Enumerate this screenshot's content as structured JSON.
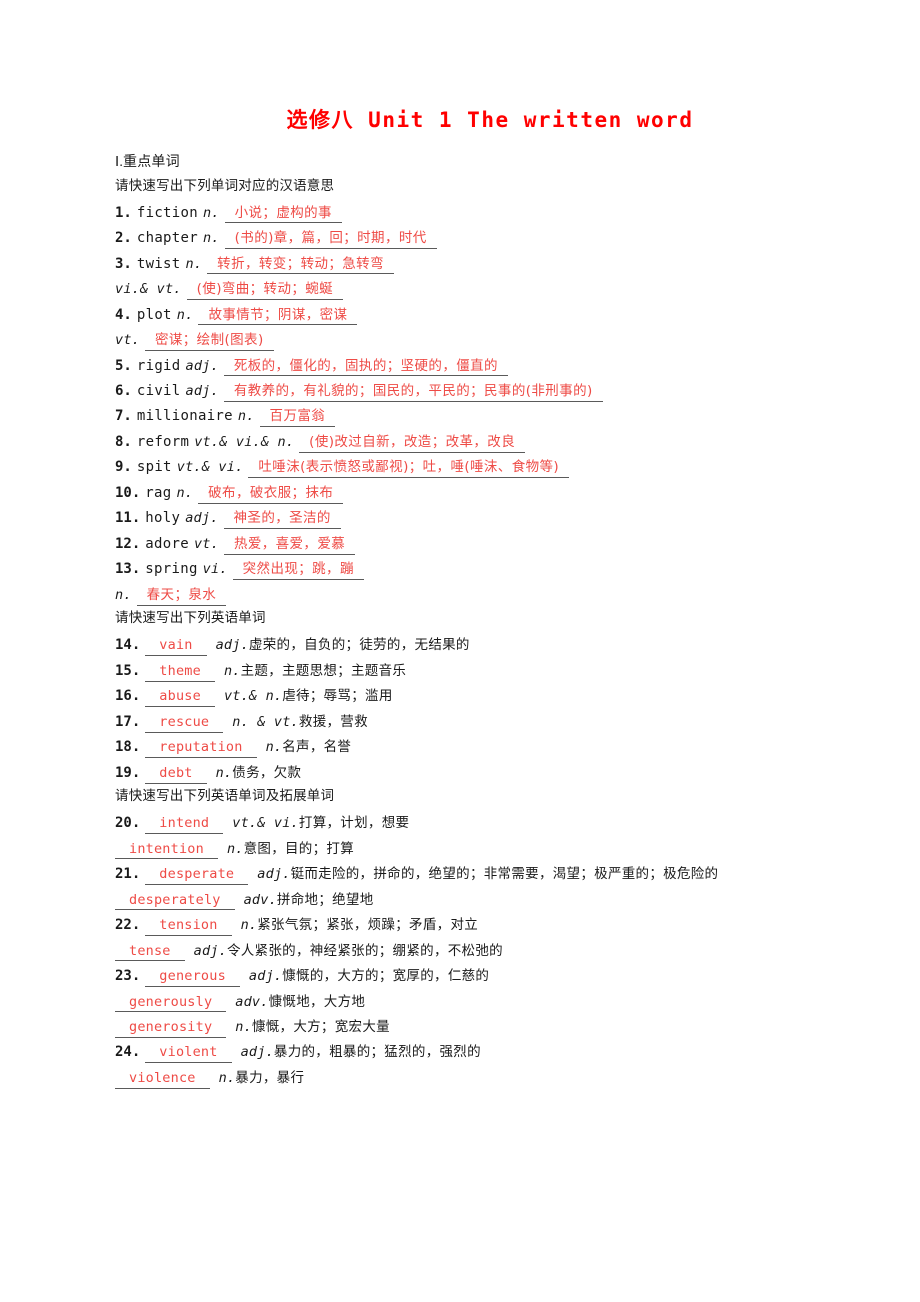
{
  "title": "选修八  Unit 1  The written word",
  "section_one_heading": "Ⅰ.重点单词",
  "prompts": {
    "zh_meaning": "请快速写出下列单词对应的汉语意思",
    "en_word": "请快速写出下列英语单词",
    "en_word_extended": "请快速写出下列英语单词及拓展单词"
  },
  "colors": {
    "title_red": "#ff0000",
    "answer_red": "#ee4b46",
    "text_black": "#1a1a1a",
    "rule_gray": "#5a5a5a"
  },
  "group_a": [
    {
      "num": "1.",
      "word": "fiction",
      "pos": "n.",
      "answer": "小说；虚构的事"
    },
    {
      "num": "2.",
      "word": "chapter",
      "pos": "n.",
      "answer": "(书的)章，篇，回；时期，时代"
    },
    {
      "num": "3.",
      "word": "twist",
      "pos": "n.",
      "answer": "转折，转变；转动；急转弯"
    },
    {
      "num": "",
      "word": "",
      "pos": "vi.& vt.",
      "answer": "(使)弯曲；转动；蜿蜒"
    },
    {
      "num": "4.",
      "word": "plot",
      "pos": "n.",
      "answer": "故事情节；阴谋，密谋"
    },
    {
      "num": "",
      "word": "",
      "pos": "vt.",
      "answer": "密谋；绘制(图表)"
    },
    {
      "num": "5.",
      "word": "rigid",
      "pos": "adj.",
      "answer": "死板的，僵化的，固执的；坚硬的，僵直的"
    },
    {
      "num": "6.",
      "word": "civil",
      "pos": "adj.",
      "answer": "有教养的，有礼貌的；国民的，平民的；民事的(非刑事的)"
    },
    {
      "num": "7.",
      "word": "millionaire",
      "pos": "n.",
      "answer": "百万富翁"
    },
    {
      "num": "8.",
      "word": "reform",
      "pos": "vt.& vi.& n.",
      "answer": "(使)改过自新，改造；改革，改良"
    },
    {
      "num": "9.",
      "word": "spit",
      "pos": "vt.& vi.",
      "answer": "吐唾沫(表示愤怒或鄙视)；吐，唾(唾沫、食物等)"
    },
    {
      "num": "10.",
      "word": "rag",
      "pos": "n.",
      "answer": "破布，破衣服；抹布"
    },
    {
      "num": "11.",
      "word": "holy",
      "pos": "adj.",
      "answer": "神圣的，圣洁的"
    },
    {
      "num": "12.",
      "word": "adore",
      "pos": "vt.",
      "answer": "热爱，喜爱，爱慕"
    },
    {
      "num": "13.",
      "word": "spring",
      "pos": "vi.",
      "answer": "突然出现；跳，蹦"
    },
    {
      "num": "",
      "word": "",
      "pos": "n.",
      "answer": "春天；泉水"
    }
  ],
  "group_b": [
    {
      "num": "14.",
      "answer": "vain",
      "pos": "adj.",
      "meaning": "虚荣的，自负的；徒劳的，无结果的"
    },
    {
      "num": "15.",
      "answer": "theme",
      "pos": "n.",
      "meaning": "主题，主题思想；主题音乐"
    },
    {
      "num": "16.",
      "answer": "abuse",
      "pos": "vt.& n.",
      "meaning": "虐待；辱骂；滥用"
    },
    {
      "num": "17.",
      "answer": "rescue",
      "pos": "n. & vt.",
      "meaning": "救援，营救"
    },
    {
      "num": "18.",
      "answer": "reputation",
      "pos": "n.",
      "meaning": "名声，名誉"
    },
    {
      "num": "19.",
      "answer": "debt",
      "pos": "n.",
      "meaning": "债务，欠款"
    }
  ],
  "group_c": [
    {
      "num": "20.",
      "answer": "intend",
      "pos": "vt.& vi.",
      "meaning": "打算，计划，想要"
    },
    {
      "num": "",
      "answer": "intention",
      "pos": "n.",
      "meaning": "意图，目的；打算"
    },
    {
      "num": "21.",
      "answer": "desperate",
      "pos": "adj.",
      "meaning": "铤而走险的，拼命的，绝望的；非常需要，渴望；极严重的；极危险的"
    },
    {
      "num": "",
      "answer": "desperately",
      "pos": "adv.",
      "meaning": "拼命地；绝望地"
    },
    {
      "num": "22.",
      "answer": "tension",
      "pos": "n.",
      "meaning": "紧张气氛；紧张，烦躁；矛盾，对立"
    },
    {
      "num": "",
      "answer": "tense",
      "pos": "adj.",
      "meaning": "令人紧张的，神经紧张的；绷紧的，不松弛的"
    },
    {
      "num": "23.",
      "answer": "generous",
      "pos": "adj.",
      "meaning": "慷慨的，大方的；宽厚的，仁慈的"
    },
    {
      "num": "",
      "answer": "generously",
      "pos": "adv.",
      "meaning": "慷慨地，大方地"
    },
    {
      "num": "",
      "answer": "generosity",
      "pos": "n.",
      "meaning": "慷慨，大方；宽宏大量"
    },
    {
      "num": "24.",
      "answer": "violent",
      "pos": "adj.",
      "meaning": "暴力的，粗暴的；猛烈的，强烈的"
    },
    {
      "num": "",
      "answer": "violence",
      "pos": "n.",
      "meaning": "暴力，暴行"
    }
  ]
}
